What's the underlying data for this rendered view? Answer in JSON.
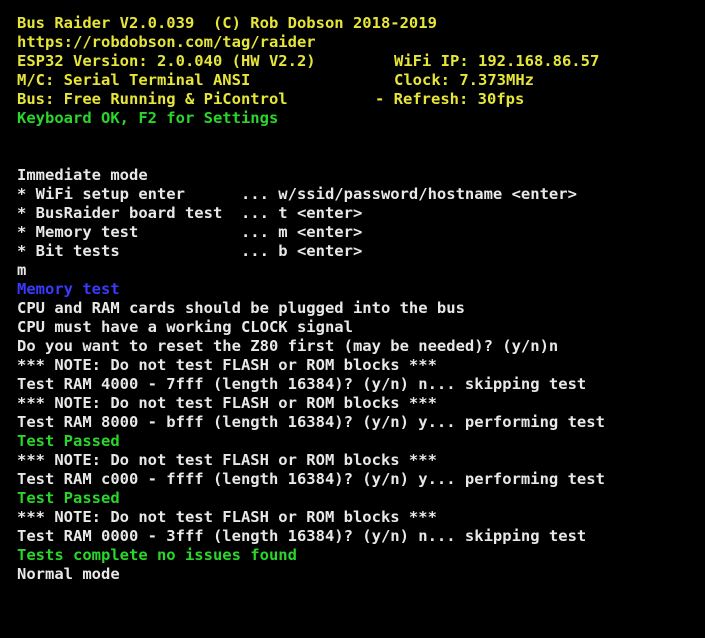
{
  "colors": {
    "background": "#000000",
    "header": "#e6e63a",
    "success": "#2ad62a",
    "text": "#e8e8e8",
    "heading": "#3a3aff"
  },
  "header": {
    "title": "Bus Raider V2.0.039  (C) Rob Dobson 2018-2019",
    "url": "https://robdobson.com/tag/raider",
    "esp32_version": "ESP32 Version: 2.0.040 (HW V2.2)",
    "wifi_ip": "WiFi IP: 192.168.86.57",
    "mc": "M/C: Serial Terminal ANSI",
    "clock": "Clock: 7.373MHz",
    "bus": "Bus: Free Running & PiControl",
    "refresh": "- Refresh: 30fps",
    "keyboard": "Keyboard OK, F2 for Settings"
  },
  "menu": {
    "mode": "Immediate mode",
    "items": [
      "* WiFi setup enter      ... w/ssid/password/hostname <enter>",
      "* BusRaider board test  ... t <enter>",
      "* Memory test           ... m <enter>",
      "* Bit tests             ... b <enter>"
    ],
    "input": "m"
  },
  "log": {
    "heading": "Memory test",
    "lines": [
      "CPU and RAM cards should be plugged into the bus",
      "CPU must have a working CLOCK signal",
      "Do you want to reset the Z80 first (may be needed)? (y/n)n",
      "*** NOTE: Do not test FLASH or ROM blocks ***",
      "Test RAM 4000 - 7fff (length 16384)? (y/n) n... skipping test",
      "*** NOTE: Do not test FLASH or ROM blocks ***",
      "Test RAM 8000 - bfff (length 16384)? (y/n) y... performing test",
      "Test Passed",
      "*** NOTE: Do not test FLASH or ROM blocks ***",
      "Test RAM c000 - ffff (length 16384)? (y/n) y... performing test",
      "Test Passed",
      "*** NOTE: Do not test FLASH or ROM blocks ***",
      "Test RAM 0000 - 3fff (length 16384)? (y/n) n... skipping test",
      "Tests complete no issues found",
      "Normal mode"
    ]
  }
}
